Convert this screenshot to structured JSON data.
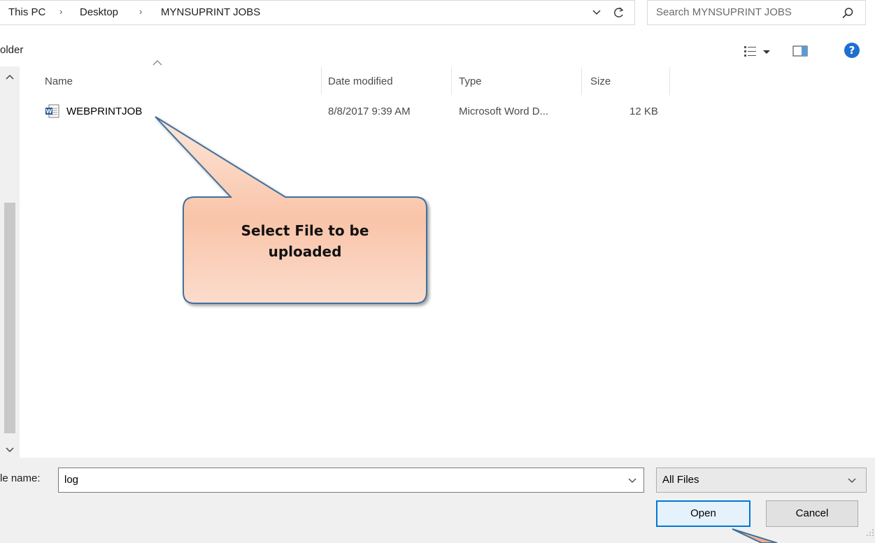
{
  "address_bar": {
    "crumbs": [
      "This PC",
      "Desktop",
      "MYNSUPRINT JOBS"
    ],
    "separator": "›"
  },
  "search": {
    "placeholder": "Search MYNSUPRINT JOBS"
  },
  "toolbar": {
    "new_folder_label": "older"
  },
  "columns": {
    "name": "Name",
    "date_modified": "Date modified",
    "type": "Type",
    "size": "Size"
  },
  "files": [
    {
      "name": "WEBPRINTJOB",
      "date_modified": "8/8/2017 9:39 AM",
      "type": "Microsoft Word D...",
      "size": "12 KB",
      "icon": "word-document-icon"
    }
  ],
  "callout": {
    "line1": "Select File to be",
    "line2": "uploaded"
  },
  "bottom": {
    "filename_label": "le name:",
    "filename_value": "log",
    "filter_value": "All Files",
    "open_label": "Open",
    "cancel_label": "Cancel"
  },
  "colors": {
    "accent": "#0078d7",
    "help_icon": "#1f6fd1",
    "callout_fill_light": "#fde3d6",
    "callout_fill_dark": "#f6b495",
    "callout_border": "#41719c"
  }
}
